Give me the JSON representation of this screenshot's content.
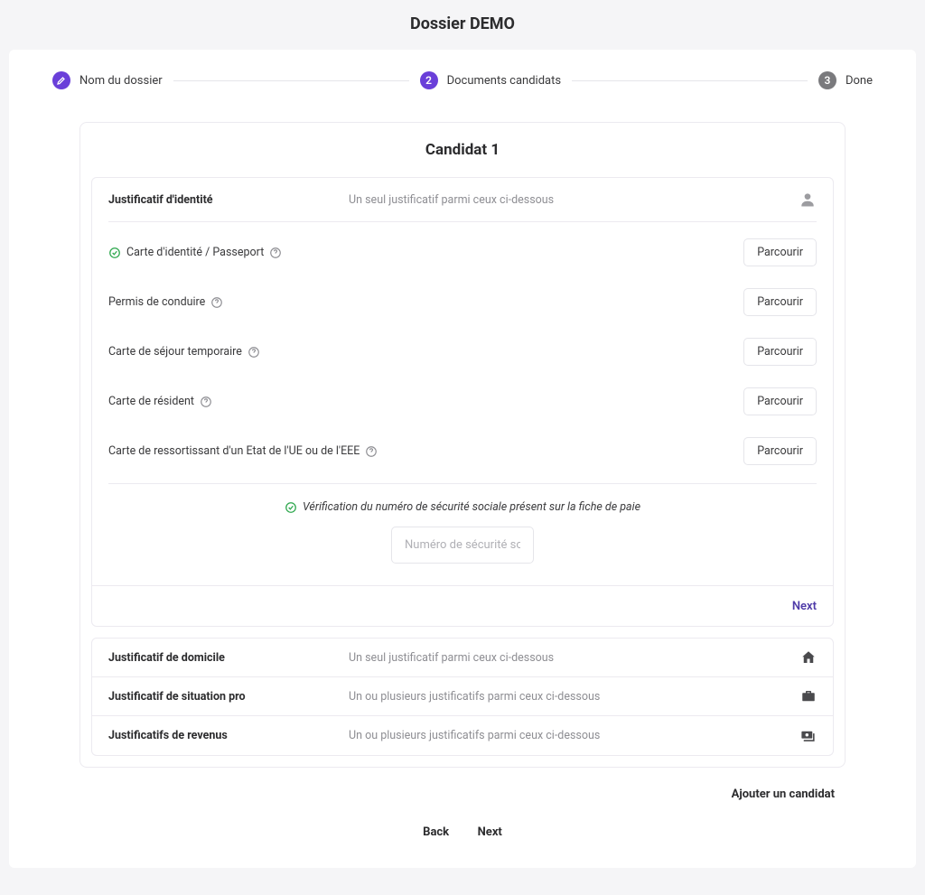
{
  "page_title": "Dossier DEMO",
  "stepper": {
    "steps": [
      {
        "label": "Nom du dossier",
        "state": "done"
      },
      {
        "label": "Documents candidats",
        "state": "active",
        "num": "2"
      },
      {
        "label": "Done",
        "state": "pending",
        "num": "3"
      }
    ]
  },
  "panel_title": "Candidat 1",
  "identity_section": {
    "title": "Justificatif d'identité",
    "desc": "Un seul justificatif parmi ceux ci-dessous",
    "docs": [
      {
        "label": "Carte d'identité / Passeport",
        "checked": true
      },
      {
        "label": "Permis de conduire",
        "checked": false
      },
      {
        "label": "Carte de séjour temporaire",
        "checked": false
      },
      {
        "label": "Carte de résident",
        "checked": false
      },
      {
        "label": "Carte de ressortissant d'un Etat de l'UE ou de l'EEE",
        "checked": false
      }
    ],
    "browse_label": "Parcourir",
    "verification_text": "Vérification du numéro de sécurité sociale présent sur la fiche de paie",
    "ssn_placeholder": "Numéro de sécurité social…",
    "next_label": "Next"
  },
  "collapsed": [
    {
      "title": "Justificatif de domicile",
      "desc": "Un seul justificatif parmi ceux ci-dessous",
      "icon": "home"
    },
    {
      "title": "Justificatif de situation pro",
      "desc": "Un ou plusieurs justificatifs parmi ceux ci-dessous",
      "icon": "briefcase"
    },
    {
      "title": "Justificatifs de revenus",
      "desc": "Un ou plusieurs justificatifs parmi ceux ci-dessous",
      "icon": "money"
    }
  ],
  "add_candidate_label": "Ajouter un candidat",
  "back_label": "Back",
  "next_bottom_label": "Next"
}
